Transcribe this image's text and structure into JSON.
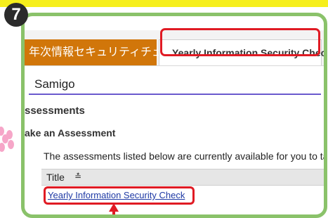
{
  "step": {
    "number": "7"
  },
  "tabs": [
    {
      "label": "年次情報セキュリティチェック"
    },
    {
      "label": "Yearly Information Security Check"
    }
  ],
  "tool": {
    "title": "Samigo"
  },
  "section": {
    "title": "ssessments"
  },
  "subsection": {
    "title": "ake an Assessment"
  },
  "intro": "The assessments listed below are currently available for you to take.",
  "table": {
    "columns": [
      {
        "label": "Title",
        "sort_icon": "≛"
      }
    ],
    "rows": [
      {
        "title": "Yearly Information Security Check"
      }
    ]
  },
  "colors": {
    "frame": "#8ac26a",
    "highlight": "#e01b24",
    "tab_orange": "#d1760a",
    "top_bar": "#f6ef1c"
  }
}
